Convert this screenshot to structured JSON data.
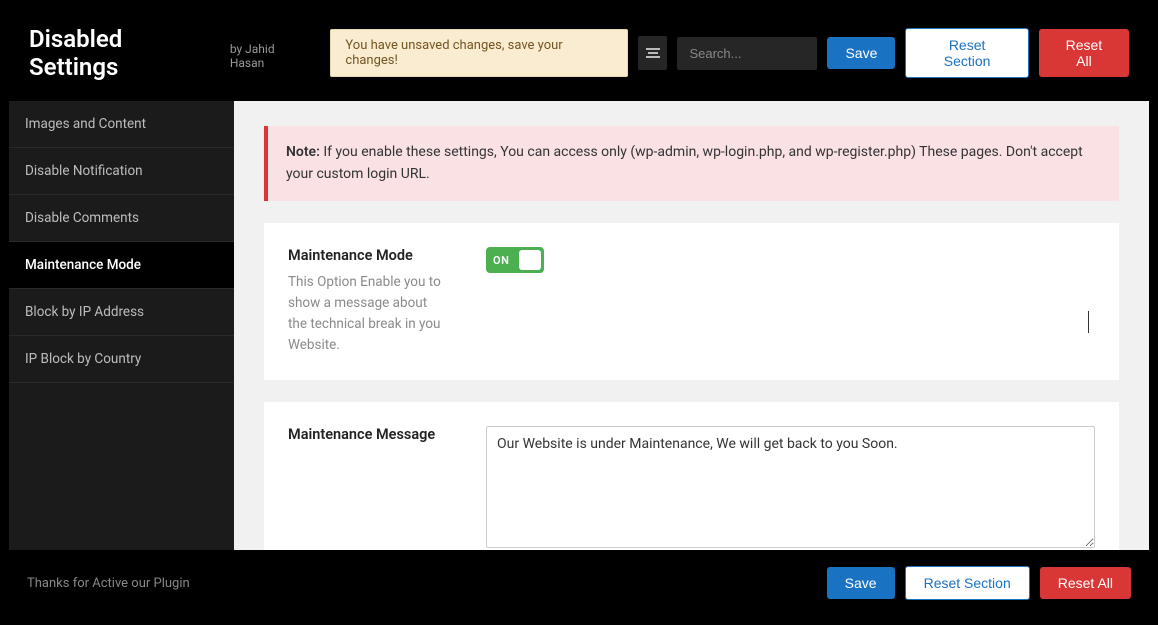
{
  "header": {
    "title": "Disabled Settings",
    "by_prefix": "by ",
    "author": "Jahid Hasan",
    "unsaved_message": "You have unsaved changes, save your changes!",
    "search_placeholder": "Search...",
    "save_label": "Save",
    "reset_section_label": "Reset Section",
    "reset_all_label": "Reset All"
  },
  "sidebar": {
    "items": [
      {
        "label": "Images and Content",
        "active": false
      },
      {
        "label": "Disable Notification",
        "active": false
      },
      {
        "label": "Disable Comments",
        "active": false
      },
      {
        "label": "Maintenance Mode",
        "active": true
      },
      {
        "label": "Block by IP Address",
        "active": false
      },
      {
        "label": "IP Block by Country",
        "active": false
      }
    ]
  },
  "note": {
    "label": "Note:",
    "text": " If you enable these settings, You can access only (wp-admin, wp-login.php, and wp-register.php) These pages. Don't accept your custom login URL."
  },
  "fields": {
    "maintenance_mode": {
      "label": "Maintenance Mode",
      "description": "This Option Enable you to show a message about the technical break in you Website.",
      "toggle_text": "ON",
      "value": true
    },
    "maintenance_message": {
      "label": "Maintenance Message",
      "value": "Our Website is under Maintenance, We will get back to you Soon."
    }
  },
  "footer": {
    "thanks_text": "Thanks for Active our Plugin",
    "save_label": "Save",
    "reset_section_label": "Reset Section",
    "reset_all_label": "Reset All"
  }
}
